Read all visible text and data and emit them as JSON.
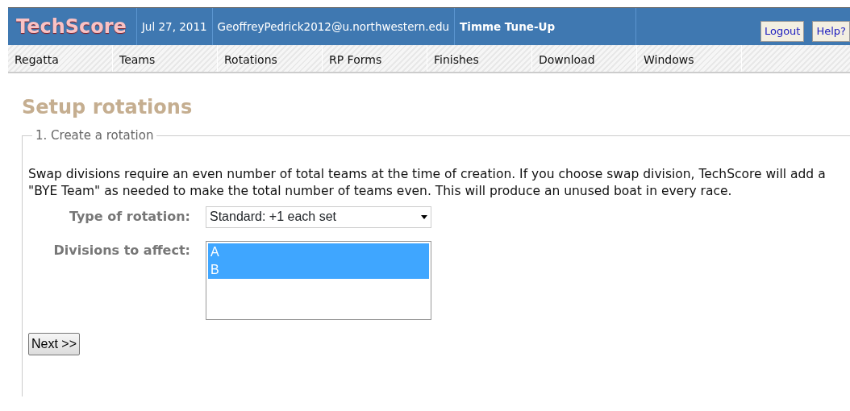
{
  "header": {
    "logo": "TechScore",
    "date": "Jul 27, 2011",
    "user": "GeoffreyPedrick2012@u.northwestern.edu",
    "regatta": "Timme Tune-Up",
    "buttons": [
      "Logout",
      "Help?"
    ]
  },
  "menu": [
    {
      "label": "Regatta"
    },
    {
      "label": "Teams"
    },
    {
      "label": "Rotations"
    },
    {
      "label": "RP Forms"
    },
    {
      "label": "Finishes"
    },
    {
      "label": "Download"
    },
    {
      "label": "Windows"
    }
  ],
  "page_title": "Setup rotations",
  "section": {
    "legend": "1. Create a rotation",
    "message": "Swap divisions require an even number of total teams at the time of creation. If you choose swap division, TechScore will add a \"BYE Team\" as needed to make the total number of teams even. This will produce an unused boat in every race.",
    "type_label": "Type of rotation:",
    "type_value": "Standard: +1 each set",
    "divisions_label": "Divisions to affect:",
    "divisions": [
      {
        "label": "A",
        "selected": true
      },
      {
        "label": "B",
        "selected": true
      }
    ],
    "next_button": "Next >>"
  }
}
